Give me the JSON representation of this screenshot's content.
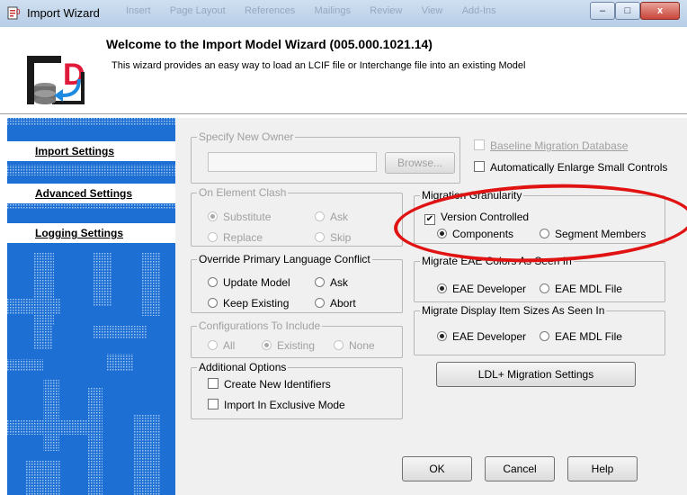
{
  "window": {
    "title": "Import Wizard",
    "ghost_tabs": [
      "Insert",
      "Page Layout",
      "References",
      "Mailings",
      "Review",
      "View",
      "Add-Ins"
    ],
    "controls": {
      "minimize": "–",
      "maximize": "□",
      "close": "x"
    }
  },
  "header": {
    "title": "Welcome to the Import Model Wizard (005.000.1021.14)",
    "description": "This wizard provides an easy way to load an LCIF file or Interchange file into an existing Model"
  },
  "sidebar": {
    "items": [
      {
        "label": "Import Settings"
      },
      {
        "label": "Advanced Settings"
      },
      {
        "label": "Logging Settings"
      }
    ]
  },
  "owner": {
    "title": "Specify New Owner",
    "value": "",
    "browse": "Browse..."
  },
  "top_checks": {
    "baseline": "Baseline Migration Database",
    "enlarge": "Automatically Enlarge Small Controls"
  },
  "clash": {
    "title": "On Element Clash",
    "substitute": "Substitute",
    "ask": "Ask",
    "replace": "Replace",
    "skip": "Skip"
  },
  "override": {
    "title": "Override Primary Language Conflict",
    "update": "Update Model",
    "ask": "Ask",
    "keep": "Keep Existing",
    "abort": "Abort"
  },
  "configs": {
    "title": "Configurations To Include",
    "all": "All",
    "existing": "Existing",
    "none": "None"
  },
  "additional": {
    "title": "Additional Options",
    "create": "Create New Identifiers",
    "exclusive": "Import In Exclusive Mode"
  },
  "granularity": {
    "title": "Migration Granularity",
    "version": "Version Controlled",
    "components": "Components",
    "segment": "Segment Members"
  },
  "eae_colors": {
    "title": "Migrate EAE Colors As Seen In",
    "developer": "EAE Developer",
    "mdl": "EAE MDL File"
  },
  "display_sizes": {
    "title": "Migrate Display Item Sizes As Seen In",
    "developer": "EAE Developer",
    "mdl": "EAE MDL File"
  },
  "ldl_button": "LDL+ Migration Settings",
  "footer": {
    "ok": "OK",
    "cancel": "Cancel",
    "help": "Help"
  },
  "colors": {
    "sidebar": "#1e6fd3",
    "highlight": "#e01212"
  }
}
